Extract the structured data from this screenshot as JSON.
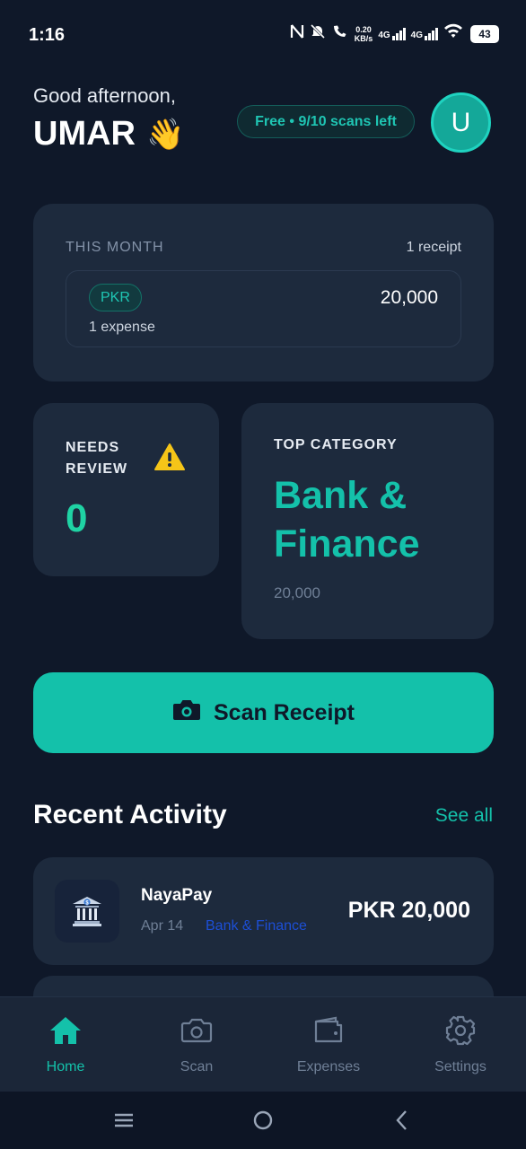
{
  "status_bar": {
    "time": "1:16",
    "net_speed_value": "0.20",
    "net_speed_unit": "KB/s",
    "network_1": "4G",
    "network_2": "4G",
    "battery": "43"
  },
  "header": {
    "greeting": "Good afternoon,",
    "username": "UMAR",
    "wave_emoji": "👋",
    "plan_badge": "Free • 9/10 scans left",
    "avatar_initial": "U"
  },
  "this_month": {
    "label": "THIS MONTH",
    "receipt_count": "1 receipt",
    "currency": "PKR",
    "expense_count": "1 expense",
    "total": "20,000"
  },
  "needs_review": {
    "label": "NEEDS REVIEW",
    "count": "0"
  },
  "top_category": {
    "label": "TOP CATEGORY",
    "name": "Bank & Finance",
    "amount": "20,000"
  },
  "scan_button": {
    "label": "Scan Receipt"
  },
  "recent_activity": {
    "title": "Recent Activity",
    "see_all": "See all",
    "items": [
      {
        "merchant": "NayaPay",
        "date": "Apr 14",
        "category": "Bank & Finance",
        "amount": "PKR 20,000",
        "icon": "bank-icon"
      }
    ]
  },
  "bottom_nav": {
    "items": [
      {
        "label": "Home",
        "icon": "home-icon",
        "active": true
      },
      {
        "label": "Scan",
        "icon": "camera-icon",
        "active": false
      },
      {
        "label": "Expenses",
        "icon": "wallet-icon",
        "active": false
      },
      {
        "label": "Settings",
        "icon": "gear-icon",
        "active": false
      }
    ]
  },
  "colors": {
    "background": "#0f1829",
    "card": "#1d2a3d",
    "accent": "#14c1aa",
    "review_count": "#1fd3a4",
    "category_link": "#1d4fd6"
  }
}
